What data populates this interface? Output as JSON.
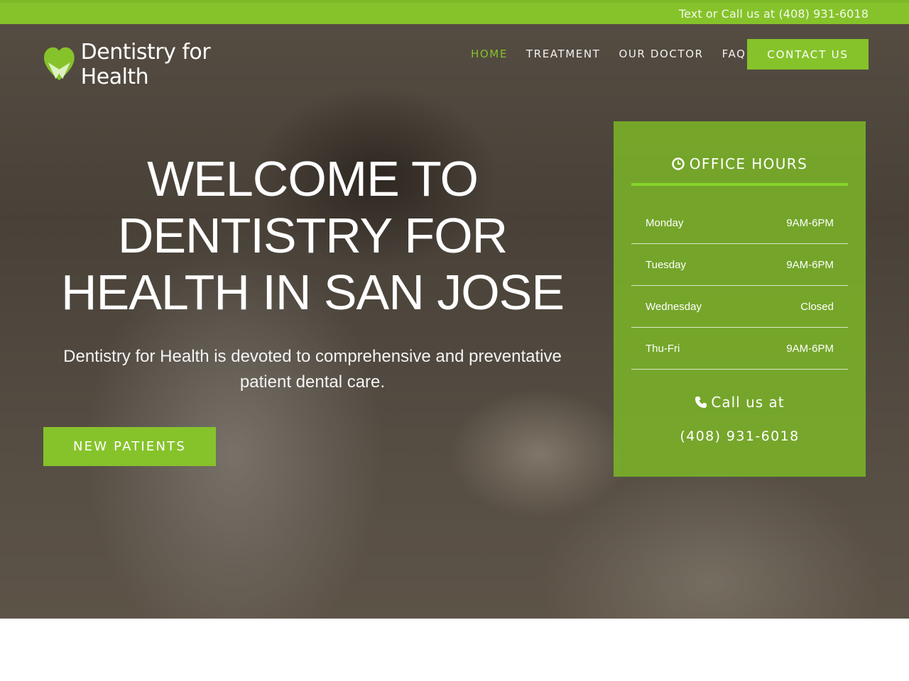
{
  "topbar": {
    "text": "Text or Call us at (408) 931-6018"
  },
  "brand": {
    "name": "Dentistry for Health"
  },
  "nav": {
    "items": [
      {
        "label": "HOME",
        "active": true
      },
      {
        "label": "TREATMENT",
        "active": false
      },
      {
        "label": "OUR DOCTOR",
        "active": false
      },
      {
        "label": "FAQ",
        "active": false
      }
    ],
    "contact_label": "CONTACT US"
  },
  "hero": {
    "headline_lines": [
      "WELCOME TO",
      "DENTISTRY FOR",
      "HEALTH IN SAN JOSE"
    ],
    "subtext": "Dentistry for Health is devoted to comprehensive and preventative patient dental care.",
    "cta_label": "NEW PATIENTS"
  },
  "hours": {
    "title": "OFFICE HOURS",
    "icon": "clock-icon",
    "rows": [
      {
        "day": "Monday",
        "time": "9AM-6PM"
      },
      {
        "day": "Tuesday",
        "time": "9AM-6PM"
      },
      {
        "day": "Wednesday",
        "time": "Closed"
      },
      {
        "day": "Thu-Fri",
        "time": "9AM-6PM"
      }
    ],
    "call_label": "Call us at",
    "call_icon": "phone-icon",
    "phone": "(408) 931-6018"
  },
  "colors": {
    "accent": "#86c32b",
    "panel": "#7cb628",
    "text_light": "#ffffff"
  }
}
